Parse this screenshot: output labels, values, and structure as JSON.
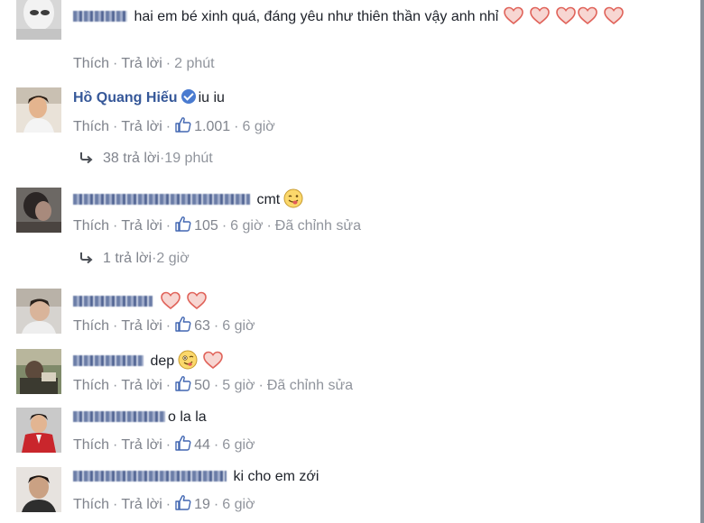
{
  "labels": {
    "like": "Thích",
    "reply": "Trả lời",
    "edited": "Đã chỉnh sửa",
    "dot": "·"
  },
  "comments": [
    {
      "author": "",
      "text": "hai em bé xinh quá, đáng yêu như thiên thần vậy anh nhỉ",
      "time": "2 phút",
      "likes": ""
    },
    {
      "author": "Hồ Quang Hiếu",
      "verified": true,
      "text": "iu iu",
      "time": "6 giờ",
      "likes": "1.001"
    },
    {
      "author": "",
      "text": "cmt",
      "time": "6 giờ",
      "likes": "105",
      "edited": true
    },
    {
      "author": "",
      "text": "",
      "time": "6 giờ",
      "likes": "63"
    },
    {
      "author": "",
      "text": "dep",
      "time": "5 giờ",
      "likes": "50",
      "edited": true
    },
    {
      "author": "",
      "text": "o la la",
      "time": "6 giờ",
      "likes": "44"
    },
    {
      "author": "",
      "text": "ki cho em zới",
      "time": "6 giờ",
      "likes": "19"
    }
  ],
  "reply_threads": [
    {
      "text": "38 trả lời",
      "time": "19 phút"
    },
    {
      "text": "1 trả lời",
      "time": "2 giờ"
    }
  ],
  "colors": {
    "link": "#365899",
    "meta": "#90949c",
    "heart": "#e9786f",
    "verified": "#4a7bd0"
  }
}
